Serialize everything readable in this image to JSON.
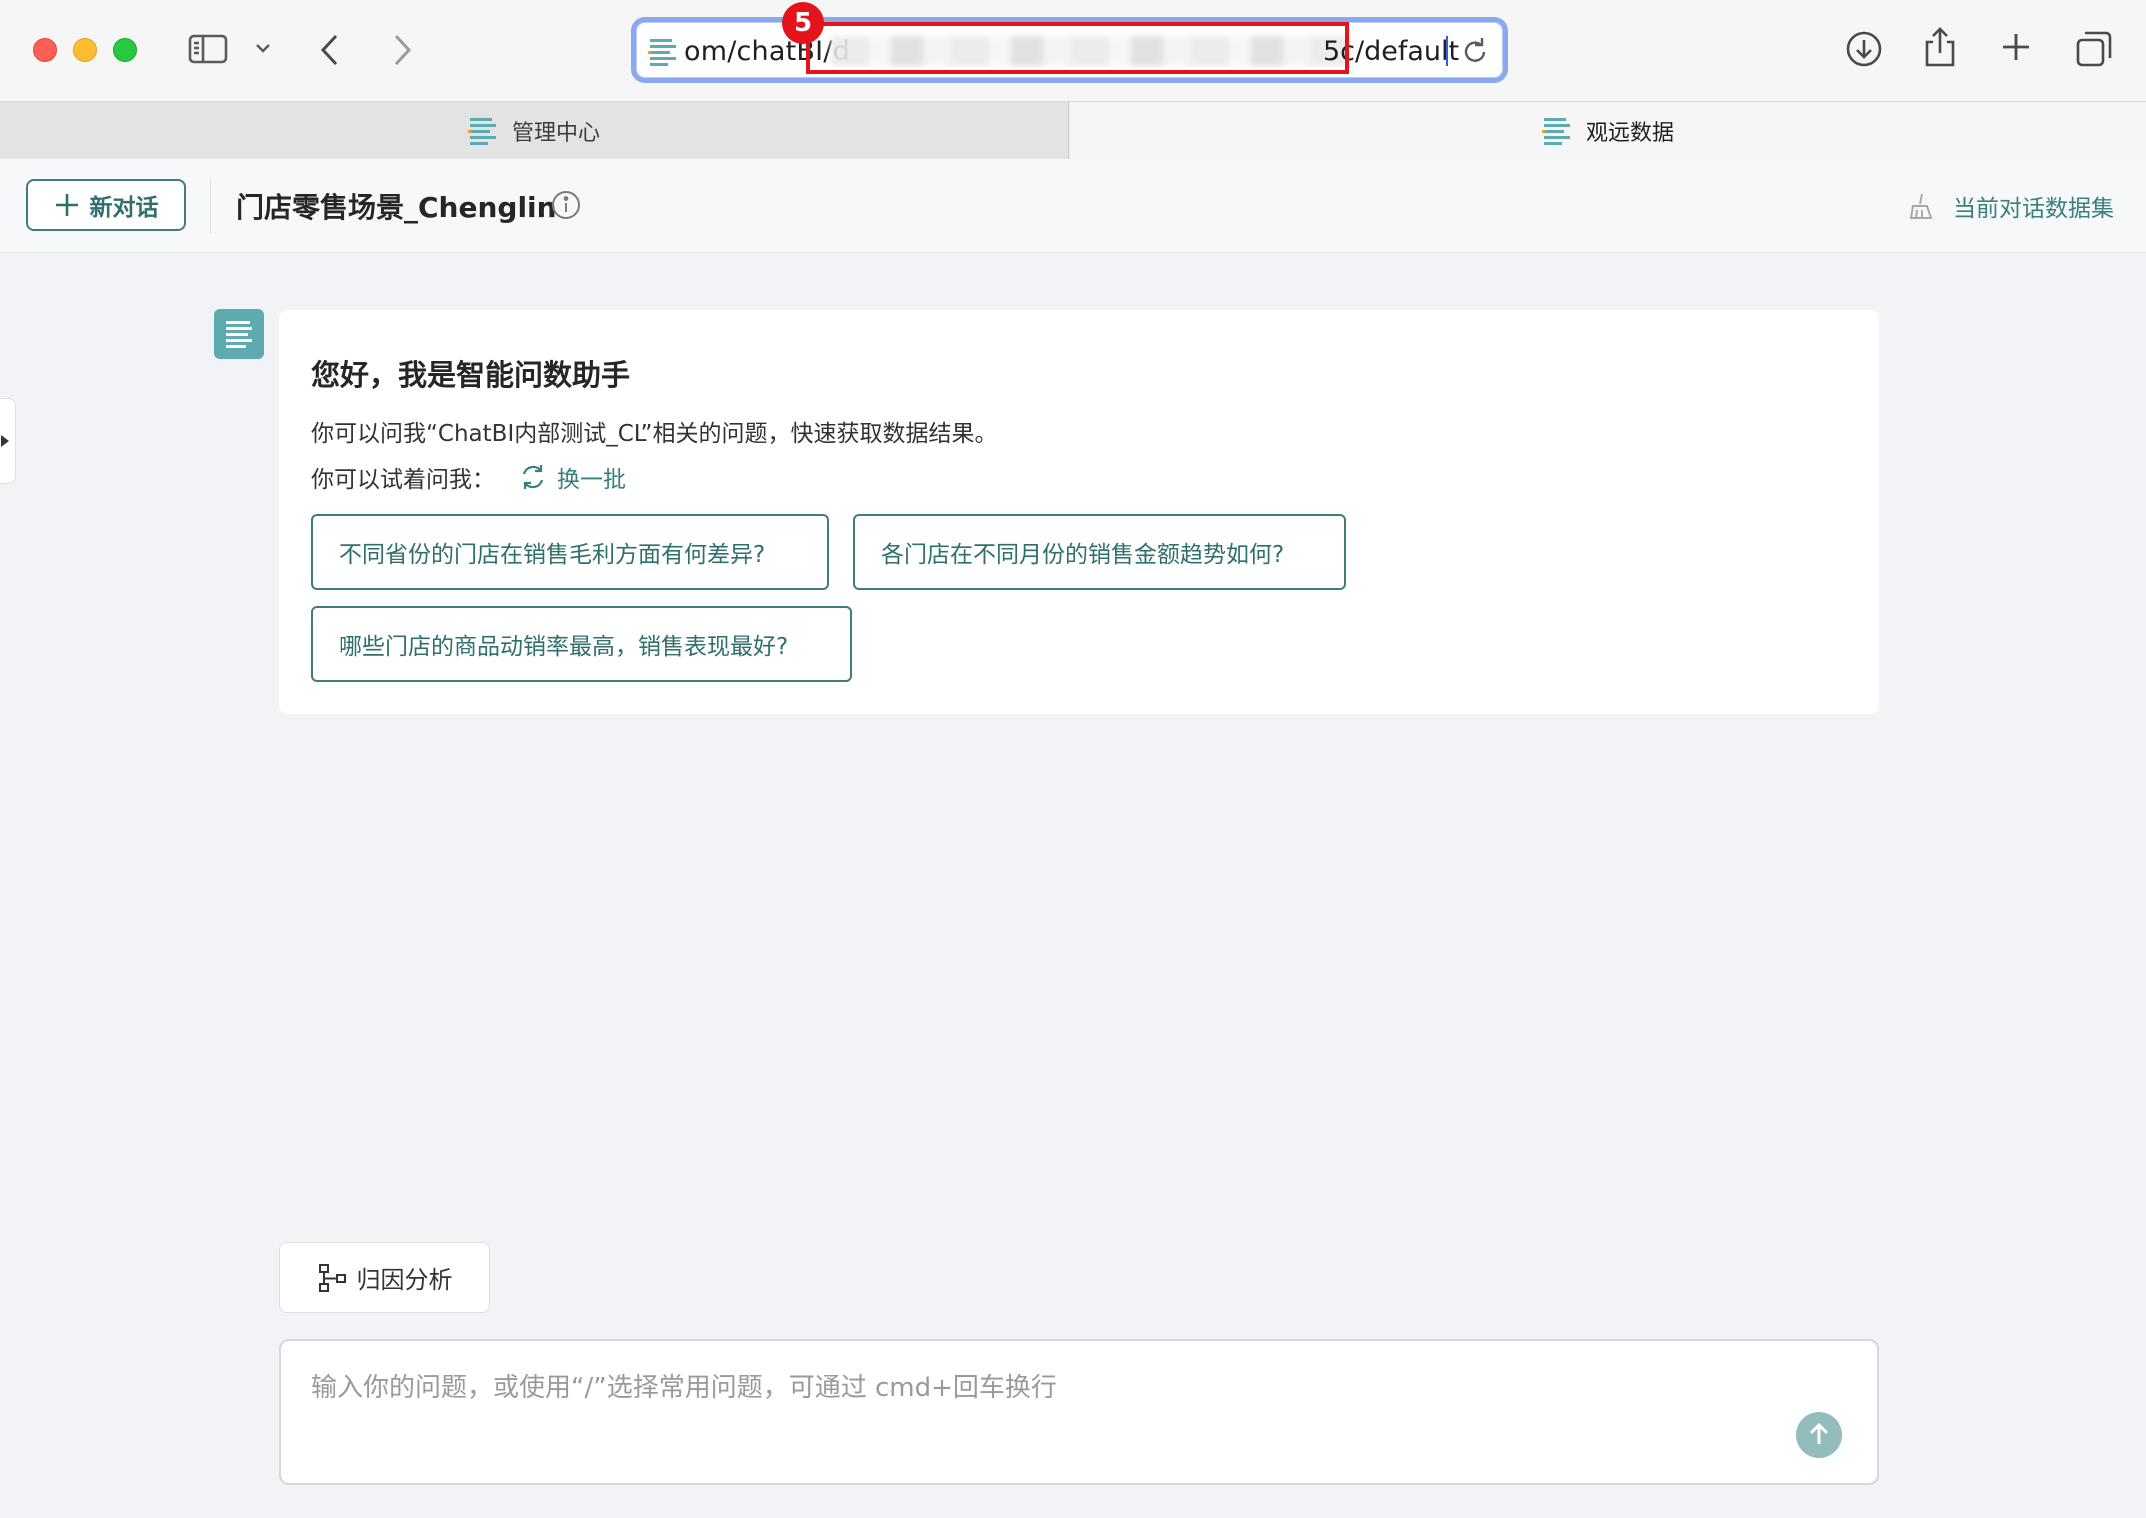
{
  "browser": {
    "url_visible_start": "om/chatBI/d",
    "url_visible_end": "5c/default",
    "annotation_step": "5"
  },
  "tabs": [
    {
      "label": "管理中心",
      "active": false
    },
    {
      "label": "观远数据",
      "active": true
    }
  ],
  "header": {
    "new_chat_label": "新对话",
    "scene_title": "门店零售场景_Chenglin",
    "dataset_link_label": "当前对话数据集"
  },
  "welcome": {
    "title": "您好，我是智能问数助手",
    "description": "你可以问我“ChatBI内部测试_CL”相关的问题，快速获取数据结果。",
    "try_label": "你可以试着问我：",
    "refresh_label": "换一批",
    "suggestions": [
      "不同省份的门店在销售毛利方面有何差异?",
      "各门店在不同月份的销售金额趋势如何?",
      "哪些门店的商品动销率最高，销售表现最好?"
    ]
  },
  "composer": {
    "attribution_label": "归因分析",
    "placeholder": "输入你的问题，或使用“/”选择常用问题，可通过 cmd+回车换行"
  },
  "colors": {
    "brand_teal": "#3e7d7a",
    "avatar_teal": "#5dabb0",
    "annotation_red": "#e3141b",
    "url_focus_ring": "#8aa8ee"
  },
  "icons": {
    "site": "lines-doc-icon",
    "info": "info-circle-icon",
    "dataset": "broom-icon",
    "refresh": "refresh-icon",
    "attribution": "tree-structure-icon",
    "send": "arrow-up-icon"
  }
}
